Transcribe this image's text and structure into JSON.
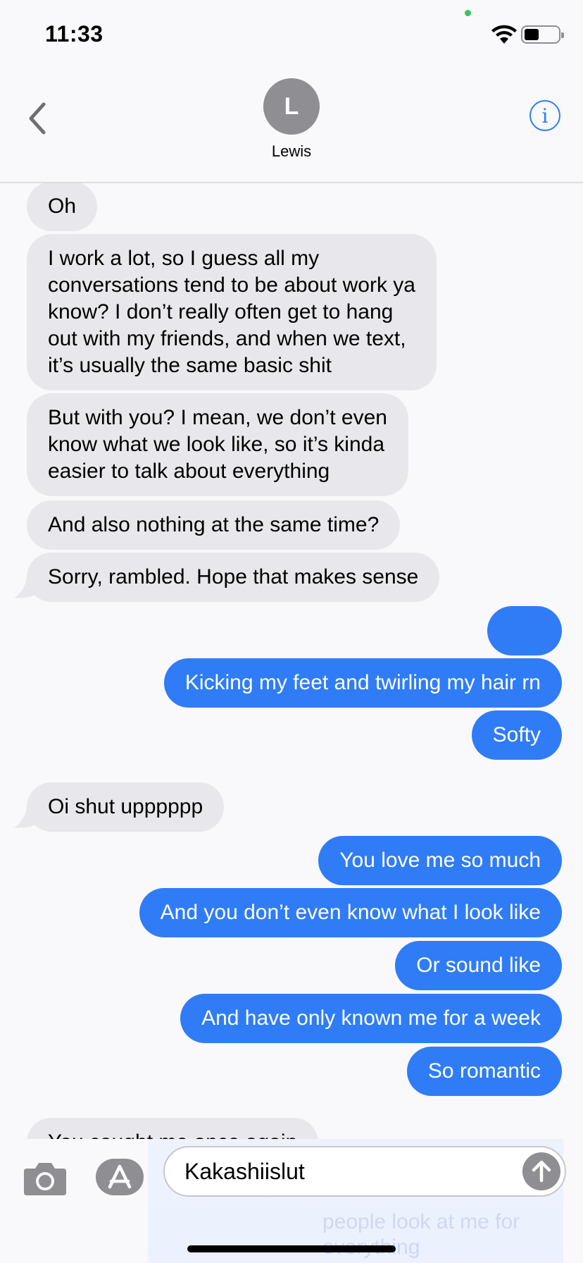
{
  "status_bar": {
    "time": "11:33"
  },
  "header": {
    "avatar_initial": "L",
    "contact_name": "Lewis",
    "info_glyph": "i"
  },
  "messages": [
    {
      "side": "in",
      "text": "Oh"
    },
    {
      "side": "in",
      "text": "I work a lot, so I guess all my\nconversations tend to be about work ya\nknow? I don’t really often get to hang\nout with my friends, and when we text,\nit’s usually the same basic shit"
    },
    {
      "side": "in",
      "text": "But with you? I mean, we don’t even\nknow what we look like, so it’s kinda\neasier to talk about everything"
    },
    {
      "side": "in",
      "text": "And also nothing at the same time?"
    },
    {
      "side": "in",
      "text": "Sorry, rambled. Hope that makes sense"
    },
    {
      "side": "out",
      "text": "",
      "emoji": "pleading-face-emoji"
    },
    {
      "side": "out",
      "text": "Kicking my feet and twirling my hair rn"
    },
    {
      "side": "out",
      "text": "Softy"
    },
    {
      "side": "in",
      "text": "Oi shut upppppp"
    },
    {
      "side": "out",
      "text": "You love me so much"
    },
    {
      "side": "out",
      "text": "And you don’t even know what I look like"
    },
    {
      "side": "out",
      "text": "Or sound like"
    },
    {
      "side": "out",
      "text": "And have only known me for a week"
    },
    {
      "side": "out",
      "text": "So romantic"
    },
    {
      "side": "in",
      "text": "You caught me once again"
    }
  ],
  "composer": {
    "value": "Kakashiislut",
    "ghost_text": "people look at me for everything"
  },
  "colors": {
    "outgoing_bubble": "#2f7cf6",
    "incoming_bubble": "#e8e8ec",
    "accent": "#2f7cf6"
  },
  "icons": [
    "back-chevron-icon",
    "info-icon",
    "camera-icon",
    "app-store-icon",
    "send-arrow-icon",
    "wifi-icon",
    "battery-icon"
  ]
}
